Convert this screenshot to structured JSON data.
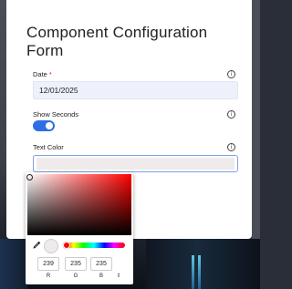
{
  "form": {
    "title": "Component Configuration Form",
    "date": {
      "label": "Date",
      "required_mark": "*",
      "value": "12/01/2025"
    },
    "show_seconds": {
      "label": "Show Seconds",
      "enabled": true
    },
    "text_color": {
      "label": "Text Color",
      "value_hex": "#efebeb"
    },
    "info_icon_glyph": "i"
  },
  "color_picker": {
    "hue_color": "#ff0000",
    "preview_color": "#efebeb",
    "rgb": {
      "r": "239",
      "g": "235",
      "b": "235"
    },
    "labels": {
      "r": "R",
      "g": "G",
      "b": "B"
    },
    "mode_toggle_glyph": "⇕"
  },
  "colors": {
    "accent": "#2f6fe6",
    "required": "#d12b2b"
  }
}
